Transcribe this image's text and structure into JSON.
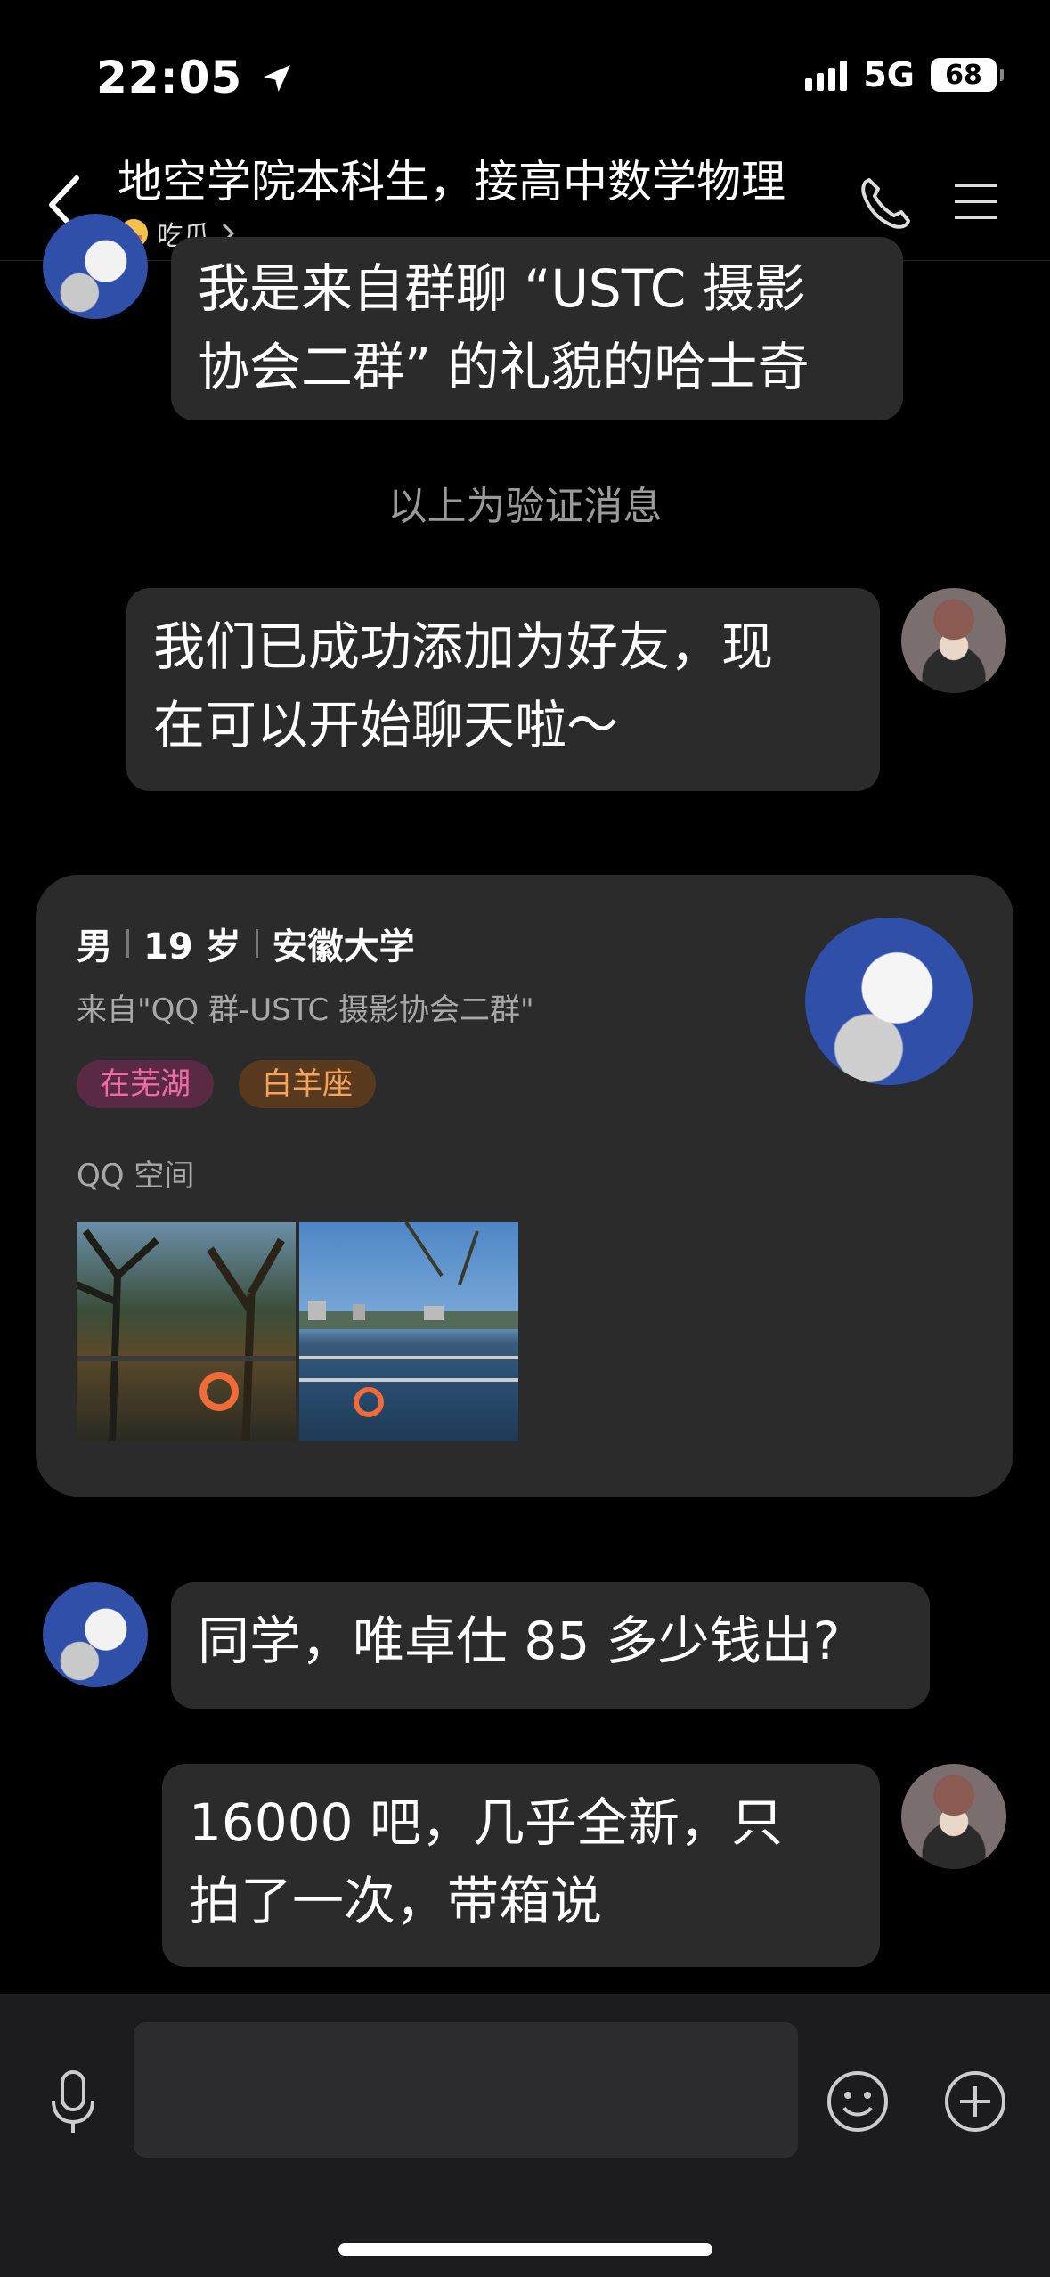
{
  "status": {
    "time": "22:05",
    "network": "5G",
    "battery": "68"
  },
  "header": {
    "title": "地空学院本科生，接高中数学物理",
    "subtitle": "吃瓜"
  },
  "messages": {
    "m1": {
      "line1": "我是来自群聊 “USTC 摄影",
      "line2": "协会二群” 的礼貌的哈士奇"
    },
    "system": "以上为验证消息",
    "m2": {
      "line1": "我们已成功添加为好友，现",
      "line2": "在可以开始聊天啦～"
    },
    "m3": "同学，唯卓仕 85 多少钱出?",
    "m4": {
      "line1": "16000 吧，几乎全新，只",
      "line2": "拍了一次，带箱说"
    }
  },
  "card": {
    "gender": "男",
    "age": "19 岁",
    "school": "安徽大学",
    "from": "来自\"QQ 群-USTC 摄影协会二群\"",
    "tags": [
      "在芜湖",
      "白羊座"
    ],
    "qzone_label": "QQ 空间"
  },
  "colors": {
    "bubble": "#2b2b2b",
    "tag_pink": "#f06aa3",
    "tag_orange": "#f7a45a"
  }
}
